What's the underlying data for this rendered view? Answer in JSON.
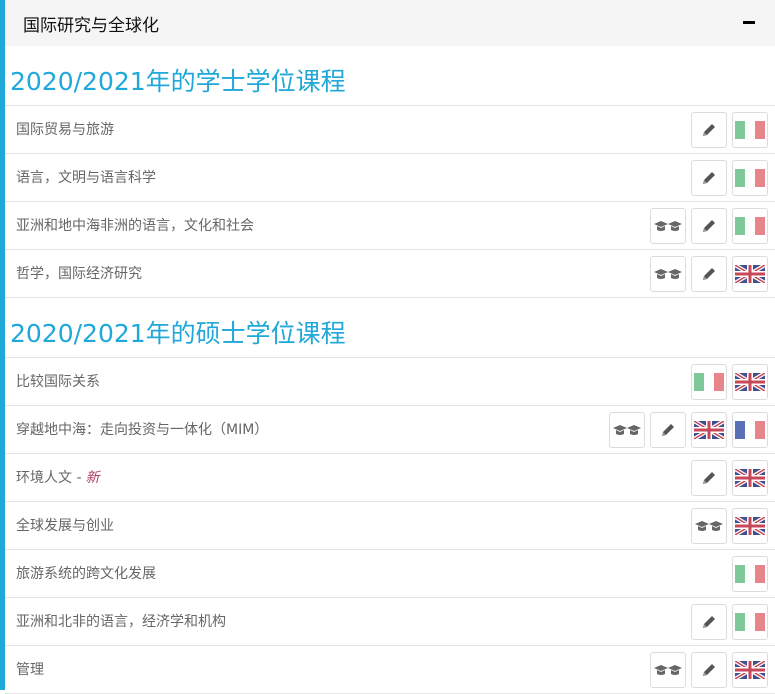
{
  "header": {
    "title": "国际研究与全球化"
  },
  "sections": [
    {
      "title": "2020/2021年的学士学位课程",
      "rows": [
        {
          "label": "国际贸易与旅游",
          "icons": [
            "pencil",
            "italy"
          ]
        },
        {
          "label": "语言，文明与语言科学",
          "icons": [
            "pencil",
            "italy"
          ]
        },
        {
          "label": "亚洲和地中海非洲的语言，文化和社会",
          "icons": [
            "graduation",
            "pencil",
            "italy"
          ]
        },
        {
          "label": "哲学，国际经济研究",
          "icons": [
            "graduation",
            "pencil",
            "uk"
          ]
        }
      ]
    },
    {
      "title": "2020/2021年的硕士学位课程",
      "rows": [
        {
          "label": "比较国际关系",
          "icons": [
            "italy",
            "uk"
          ]
        },
        {
          "label": "穿越地中海：走向投资与一体化（MIM）",
          "icons": [
            "graduation",
            "pencil",
            "uk",
            "france"
          ]
        },
        {
          "label": "环境人文 -",
          "tag": "新",
          "icons": [
            "pencil",
            "uk"
          ]
        },
        {
          "label": "全球发展与创业",
          "icons": [
            "graduation",
            "uk"
          ]
        },
        {
          "label": "旅游系统的跨文化发展",
          "icons": [
            "italy"
          ]
        },
        {
          "label": "亚洲和北非的语言，经济学和机构",
          "icons": [
            "pencil",
            "italy"
          ]
        },
        {
          "label": "管理",
          "icons": [
            "graduation",
            "pencil",
            "uk"
          ]
        }
      ]
    }
  ],
  "icon_names": {
    "pencil": "pencil-icon",
    "graduation": "graduation-caps-icon",
    "italy": "italian-flag-icon",
    "uk": "uk-flag-icon",
    "france": "french-flag-icon"
  },
  "colors": {
    "accent": "#1fa8d8",
    "italy_green": "#7fc89a",
    "italy_red": "#e8858a",
    "france_blue": "#5a6fb4"
  }
}
